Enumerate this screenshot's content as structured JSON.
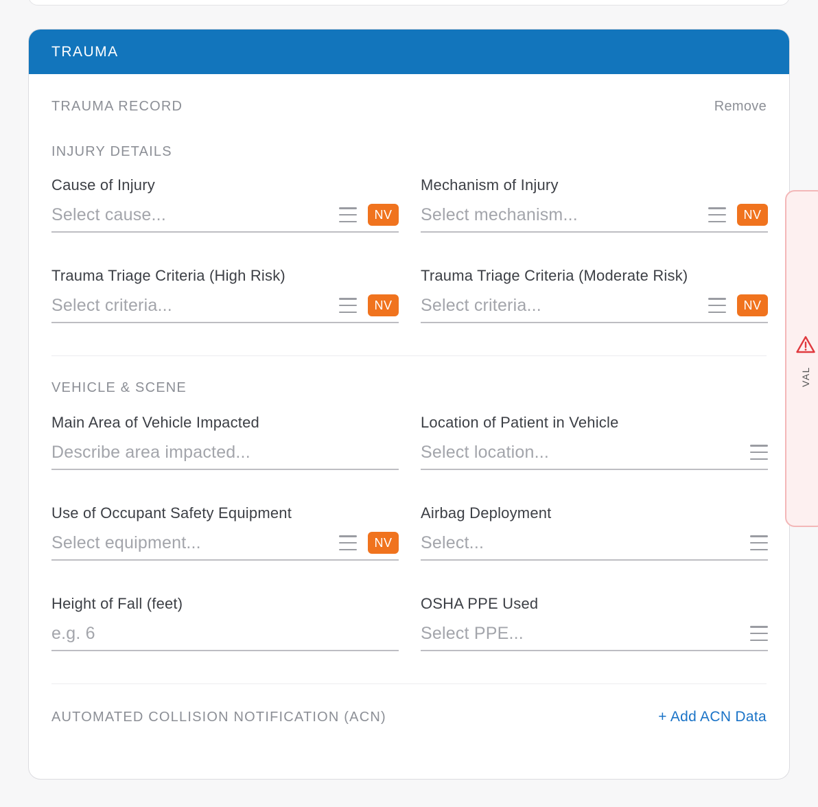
{
  "section": {
    "title": "TRAUMA",
    "record_title": "TRAUMA RECORD",
    "remove_label": "Remove"
  },
  "injury_details": {
    "heading": "INJURY DETAILS",
    "fields": [
      {
        "label": "Cause of Injury",
        "placeholder": "Select cause...",
        "nv": "NV"
      },
      {
        "label": "Mechanism of Injury",
        "placeholder": "Select mechanism...",
        "nv": "NV"
      },
      {
        "label": "Trauma Triage Criteria (High Risk)",
        "placeholder": "Select criteria...",
        "nv": "NV"
      },
      {
        "label": "Trauma Triage Criteria (Moderate Risk)",
        "placeholder": "Select criteria...",
        "nv": "NV"
      }
    ]
  },
  "vehicle_scene": {
    "heading": "VEHICLE & SCENE",
    "fields": [
      {
        "label": "Main Area of Vehicle Impacted",
        "placeholder": "Describe area impacted..."
      },
      {
        "label": "Location of Patient in Vehicle",
        "placeholder": "Select location..."
      },
      {
        "label": "Use of Occupant Safety Equipment",
        "placeholder": "Select equipment...",
        "nv": "NV"
      },
      {
        "label": "Airbag Deployment",
        "placeholder": "Select..."
      },
      {
        "label": "Height of Fall (feet)",
        "placeholder": "e.g. 6"
      },
      {
        "label": "OSHA PPE Used",
        "placeholder": "Select PPE..."
      }
    ]
  },
  "acn": {
    "heading": "AUTOMATED COLLISION NOTIFICATION (ACN)",
    "add_label": "+ Add ACN Data"
  },
  "validation_tab": {
    "label": "VAL",
    "icon": "warning-triangle-icon"
  },
  "colors": {
    "header_bg": "#1275bc",
    "nv_badge": "#f0731e",
    "link": "#1a73c7",
    "val_border": "#f3b7b8",
    "val_icon": "#e0393e"
  }
}
